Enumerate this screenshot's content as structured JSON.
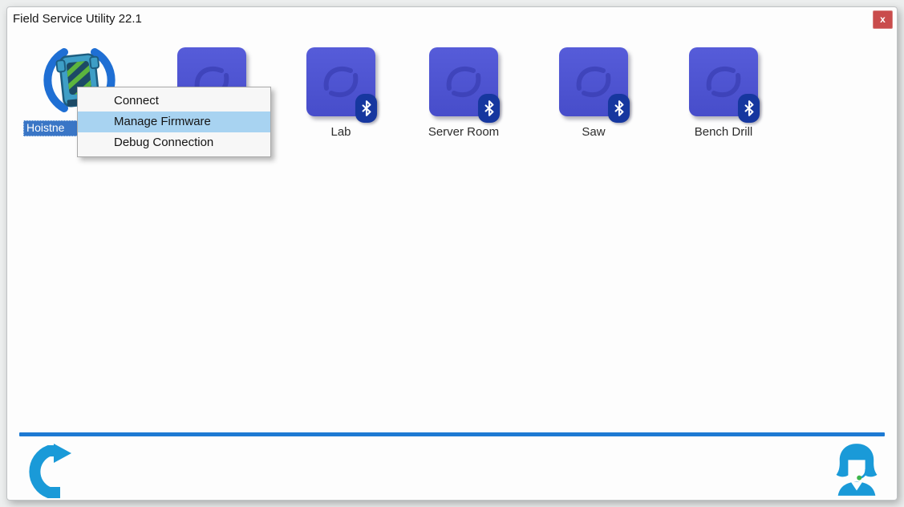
{
  "window": {
    "title": "Field Service Utility 22.1",
    "close_glyph": "x"
  },
  "context_menu": {
    "items": [
      {
        "label": "Connect",
        "highlighted": false
      },
      {
        "label": "Manage Firmware",
        "highlighted": true
      },
      {
        "label": "Debug Connection",
        "highlighted": false
      }
    ]
  },
  "devices": [
    {
      "label": "Hoistne",
      "selected": true,
      "icon": "hoist-with-signal-arcs",
      "bluetooth": false
    },
    {
      "label": "",
      "icon": "swirl-box",
      "bluetooth": false
    },
    {
      "label": "Lab",
      "icon": "swirl-box",
      "bluetooth": true
    },
    {
      "label": "Server Room",
      "icon": "swirl-box",
      "bluetooth": true
    },
    {
      "label": "Saw",
      "icon": "swirl-box",
      "bluetooth": true
    },
    {
      "label": "Bench Drill",
      "icon": "swirl-box",
      "bluetooth": true
    }
  ],
  "footer": {
    "icons": [
      {
        "name": "refresh-icon"
      },
      {
        "name": "support-agent-icon"
      }
    ]
  },
  "colors": {
    "device_blue": "#4a50cf",
    "swirl_blue": "#3a3fb4",
    "bluetooth_badge_navy": "#16379f",
    "menu_highlight_blue": "#a8d3f1",
    "selected_label_blue": "#3a76c6",
    "divider_blue": "#1d7ad3",
    "footer_icon_blue": "#1a9ad8",
    "close_button_red": "#c94c4c",
    "hoist_teal": "#3e9ec6",
    "hoist_stripe_green": "#5cb53e"
  }
}
